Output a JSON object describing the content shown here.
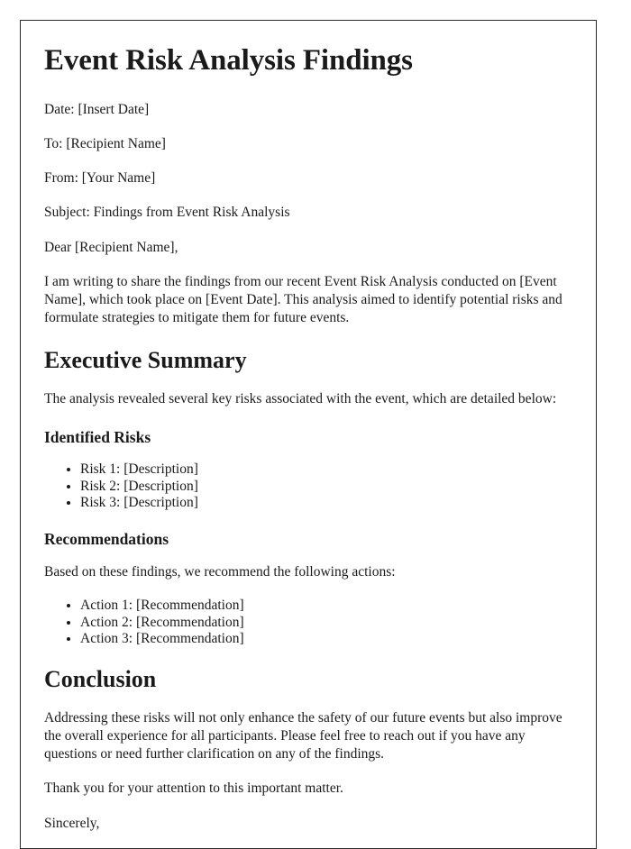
{
  "document": {
    "title": "Event Risk Analysis Findings",
    "meta_lines": [
      "Date: [Insert Date]",
      "To: [Recipient Name]",
      "From: [Your Name]",
      "Subject: Findings from Event Risk Analysis"
    ],
    "salutation": "Dear [Recipient Name],",
    "intro_paragraph": "I am writing to share the findings from our recent Event Risk Analysis conducted on [Event Name], which took place on [Event Date]. This analysis aimed to identify potential risks and formulate strategies to mitigate them for future events.",
    "executive_summary": {
      "heading": "Executive Summary",
      "intro": "The analysis revealed several key risks associated with the event, which are detailed below:",
      "identified_risks": {
        "heading": "Identified Risks",
        "items": [
          "Risk 1: [Description]",
          "Risk 2: [Description]",
          "Risk 3: [Description]"
        ]
      },
      "recommendations": {
        "heading": "Recommendations",
        "intro": "Based on these findings, we recommend the following actions:",
        "items": [
          "Action 1: [Recommendation]",
          "Action 2: [Recommendation]",
          "Action 3: [Recommendation]"
        ]
      }
    },
    "conclusion": {
      "heading": "Conclusion",
      "paragraph": "Addressing these risks will not only enhance the safety of our future events but also improve the overall experience for all participants. Please feel free to reach out if you have any questions or need further clarification on any of the findings.",
      "thanks": "Thank you for your attention to this important matter.",
      "closing": "Sincerely,"
    }
  },
  "colors": {
    "text": "#1a1a1a",
    "page_border": "#2b2b2b",
    "page_background": "#ffffff"
  }
}
